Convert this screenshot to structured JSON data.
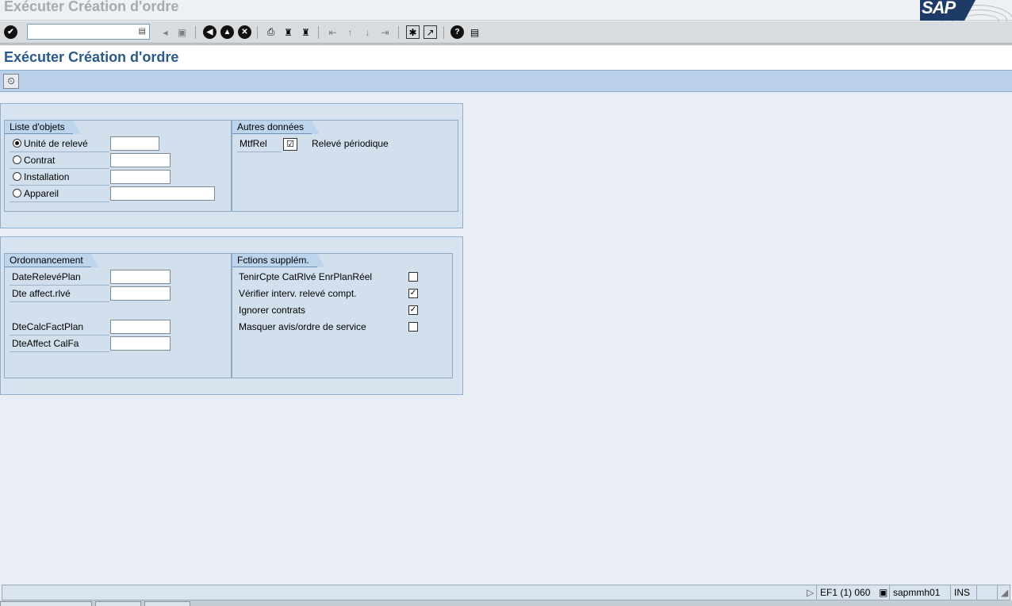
{
  "window": {
    "title": "Exécuter Création d'ordre",
    "logo_text": "SAP"
  },
  "toolbar": {
    "command_field_value": "",
    "dropdown_glyph": "▤"
  },
  "page": {
    "title": "Exécuter Création d'ordre"
  },
  "object_list": {
    "title": "Liste d'objets",
    "options": [
      {
        "label": "Unité de relevé",
        "selected": true,
        "value": ""
      },
      {
        "label": "Contrat",
        "selected": false,
        "value": ""
      },
      {
        "label": "Installation",
        "selected": false,
        "value": ""
      },
      {
        "label": "Appareil",
        "selected": false,
        "value": ""
      }
    ]
  },
  "other_data": {
    "title": "Autres données",
    "reason_label": "MtfRel",
    "reason_checked": true,
    "reason_text": "Relevé périodique"
  },
  "scheduling": {
    "title": "Ordonnancement",
    "fields": [
      {
        "label": "DateRelevéPlan",
        "value": ""
      },
      {
        "label": "Dte affect.rlvé",
        "value": ""
      },
      {
        "label": "DteCalcFactPlan",
        "value": ""
      },
      {
        "label": "DteAffect CalFa",
        "value": ""
      }
    ]
  },
  "extra_functions": {
    "title": "Fctions supplém.",
    "items": [
      {
        "label": "TenirCpte CatRlvé EnrPlanRéel",
        "checked": false
      },
      {
        "label": "Vérifier interv. relevé compt.",
        "checked": true
      },
      {
        "label": "Ignorer contrats",
        "checked": true
      },
      {
        "label": "Masquer avis/ordre de service",
        "checked": false
      }
    ]
  },
  "status_bar": {
    "system": "EF1 (1) 060",
    "server": "sapmmh01",
    "mode": "INS"
  }
}
